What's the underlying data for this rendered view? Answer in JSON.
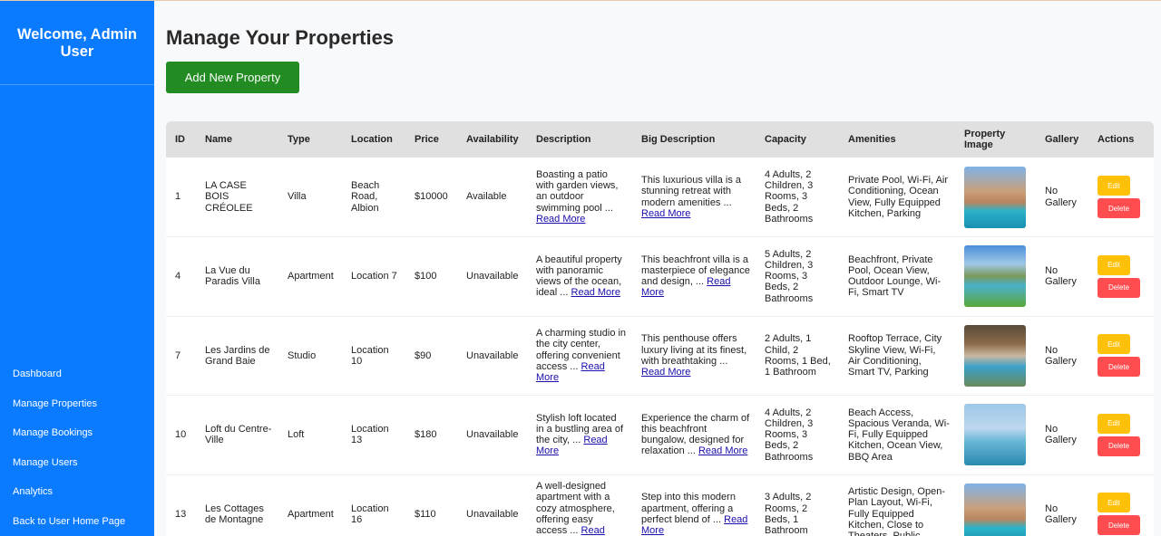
{
  "sidebar": {
    "welcome": "Welcome, Admin User",
    "nav": [
      "Dashboard",
      "Manage Properties",
      "Manage Bookings",
      "Manage Users",
      "Analytics",
      "Back to User Home Page"
    ]
  },
  "page": {
    "title": "Manage Your Properties",
    "add_button": "Add New Property"
  },
  "table": {
    "headers": [
      "ID",
      "Name",
      "Type",
      "Location",
      "Price",
      "Availability",
      "Description",
      "Big Description",
      "Capacity",
      "Amenities",
      "Property Image",
      "Gallery",
      "Actions"
    ],
    "read_more": "Read More",
    "edit_label": "Edit",
    "delete_label": "Delete",
    "rows": [
      {
        "id": "1",
        "name": "LA CASE BOIS CRÉOLEE",
        "type": "Villa",
        "location": "Beach Road, Albion",
        "price": "$10000",
        "availability": "Available",
        "description": "Boasting a patio with garden views, an outdoor swimming pool ...",
        "big_description": "This luxurious villa is a stunning retreat with modern amenities ...",
        "capacity": "4 Adults, 2 Children, 3 Rooms, 3 Beds, 2 Bathrooms",
        "amenities": "Private Pool, Wi-Fi, Air Conditioning, Ocean View, Fully Equipped Kitchen, Parking",
        "gallery": "No Gallery"
      },
      {
        "id": "4",
        "name": "La Vue du Paradis Villa",
        "type": "Apartment",
        "location": "Location 7",
        "price": "$100",
        "availability": "Unavailable",
        "description": "A beautiful property with panoramic views of the ocean, ideal ...",
        "big_description": "This beachfront villa is a masterpiece of elegance and design, ...",
        "capacity": "5 Adults, 2 Children, 3 Rooms, 3 Beds, 2 Bathrooms",
        "amenities": "Beachfront, Private Pool, Ocean View, Outdoor Lounge, Wi-Fi, Smart TV",
        "gallery": "No Gallery"
      },
      {
        "id": "7",
        "name": "Les Jardins de Grand Baie",
        "type": "Studio",
        "location": "Location 10",
        "price": "$90",
        "availability": "Unavailable",
        "description": "A charming studio in the city center, offering convenient access ...",
        "big_description": "This penthouse offers luxury living at its finest, with breathtaking ...",
        "capacity": "2 Adults, 1 Child, 2 Rooms, 1 Bed, 1 Bathroom",
        "amenities": "Rooftop Terrace, City Skyline View, Wi-Fi, Air Conditioning, Smart TV, Parking",
        "gallery": "No Gallery"
      },
      {
        "id": "10",
        "name": "Loft du Centre-Ville",
        "type": "Loft",
        "location": "Location 13",
        "price": "$180",
        "availability": "Unavailable",
        "description": "Stylish loft located in a bustling area of the city, ...",
        "big_description": "Experience the charm of this beachfront bungalow, designed for relaxation ...",
        "capacity": "4 Adults, 2 Children, 3 Rooms, 3 Beds, 2 Bathrooms",
        "amenities": "Beach Access, Spacious Veranda, Wi-Fi, Fully Equipped Kitchen, Ocean View, BBQ Area",
        "gallery": "No Gallery"
      },
      {
        "id": "13",
        "name": "Les Cottages de Montagne",
        "type": "Apartment",
        "location": "Location 16",
        "price": "$110",
        "availability": "Unavailable",
        "description": "A well-designed apartment with a cozy atmosphere, offering easy access ...",
        "big_description": "Step into this modern apartment, offering a perfect blend of ...",
        "capacity": "3 Adults, 2 Rooms, 2 Beds, 1 Bathroom",
        "amenities": "Artistic Design, Open-Plan Layout, Wi-Fi, Fully Equipped Kitchen, Close to Theaters, Public",
        "gallery": "No Gallery"
      }
    ]
  },
  "colors": {
    "sidebar": "#0a7bff",
    "add_button": "#228b22",
    "edit_button": "#ffc107",
    "delete_button": "#ff4d4f",
    "table_header": "#e0e0e0"
  }
}
